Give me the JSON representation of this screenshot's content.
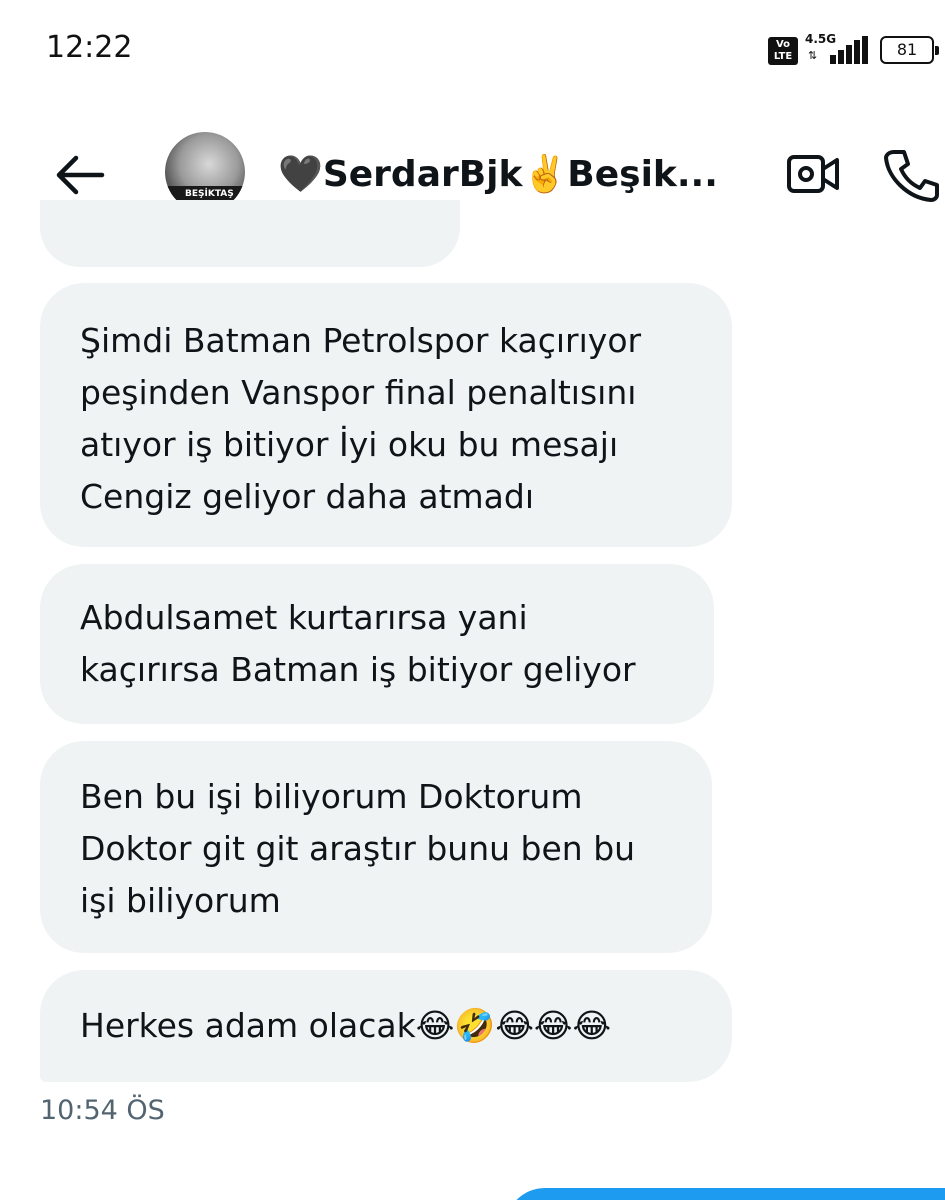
{
  "status_bar": {
    "time": "12:22",
    "volte_line1": "Vo",
    "volte_line2": "LTE",
    "network": "4.5G",
    "battery": "81"
  },
  "header": {
    "back_icon": "arrow-left-icon",
    "avatar_text": "BEŞİKTAŞ",
    "name": "🖤SerdarBjk✌️Beşik...",
    "video_icon": "video-camera-icon",
    "call_icon": "phone-icon"
  },
  "messages": [
    {
      "lines": [
        "Şimdi Batman Petrolspor kaçırıyor",
        "peşinden Vanspor final penaltısını",
        "atıyor iş bitiyor İyi oku bu mesajı",
        "Cengiz geliyor daha atmadı"
      ]
    },
    {
      "lines": [
        "Abdulsamet kurtarırsa yani",
        "kaçırırsa Batman iş bitiyor geliyor"
      ]
    },
    {
      "lines": [
        "Ben bu işi biliyorum Doktorum",
        "Doktor git git araştır bunu ben bu",
        "işi biliyorum"
      ]
    },
    {
      "lines": [
        "Herkes adam olacak😂🤣😂😂😂"
      ]
    }
  ],
  "timestamp": "10:54 ÖS",
  "colors": {
    "bubble_bg": "#eff3f4",
    "text": "#0f1419",
    "muted": "#536471",
    "accent": "#1d9bf0"
  }
}
